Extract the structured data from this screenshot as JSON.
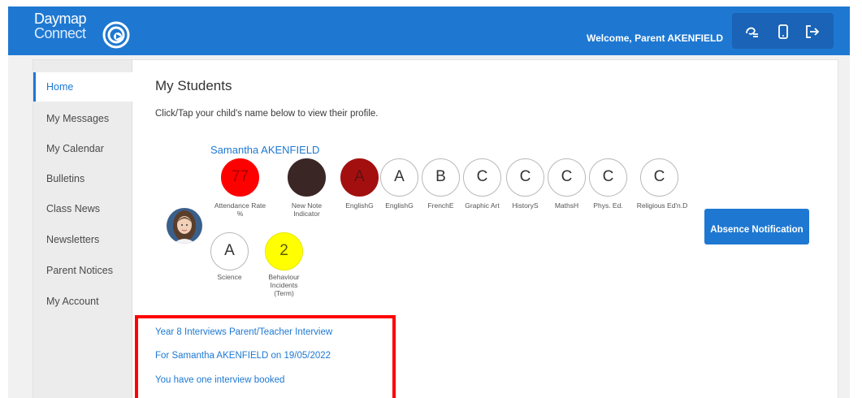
{
  "header": {
    "logo_line1": "Daymap",
    "logo_line2": "Connect",
    "welcome": "Welcome, Parent AKENFIELD",
    "icons": [
      "collapse-menu-icon",
      "mobile-phone-icon",
      "logout-icon"
    ]
  },
  "sidebar": {
    "items": [
      {
        "label": "Home",
        "active": true
      },
      {
        "label": "My Messages"
      },
      {
        "label": "My Calendar"
      },
      {
        "label": "Bulletins"
      },
      {
        "label": "Class News"
      },
      {
        "label": "Newsletters"
      },
      {
        "label": "Parent Notices"
      },
      {
        "label": "My Account"
      }
    ]
  },
  "main": {
    "title": "My Students",
    "subtitle": "Click/Tap your child's name below to view their profile.",
    "student": {
      "name": "Samantha AKENFIELD",
      "badges": [
        {
          "value": "77",
          "label": "Attendance Rate %",
          "color": "#ff0000"
        },
        {
          "value": "1",
          "label": "New Note Indicator",
          "color": "#3b2626"
        },
        {
          "value": "A",
          "label": "EnglishG",
          "color": "#a30f0f"
        },
        {
          "value": "A",
          "label": "EnglishG"
        },
        {
          "value": "B",
          "label": "FrenchE"
        },
        {
          "value": "C",
          "label": "Graphic Art"
        },
        {
          "value": "C",
          "label": "HistoryS"
        },
        {
          "value": "C",
          "label": "MathsH"
        },
        {
          "value": "C",
          "label": "Phys. Ed."
        },
        {
          "value": "C",
          "label": "Religious Ed'n.D"
        },
        {
          "value": "A",
          "label": "Science"
        },
        {
          "value": "2",
          "label": "Behaviour Incidents (Term)",
          "color": "#ffff00"
        }
      ]
    },
    "absence_button": "Absence Notification",
    "interviews": {
      "line1": "Year 8 Interviews Parent/Teacher Interview",
      "line2": "For Samantha AKENFIELD on 19/05/2022",
      "line3": "You have one interview booked"
    }
  },
  "colors": {
    "brand": "#1e78d2",
    "highlight_border": "#ff0000"
  }
}
